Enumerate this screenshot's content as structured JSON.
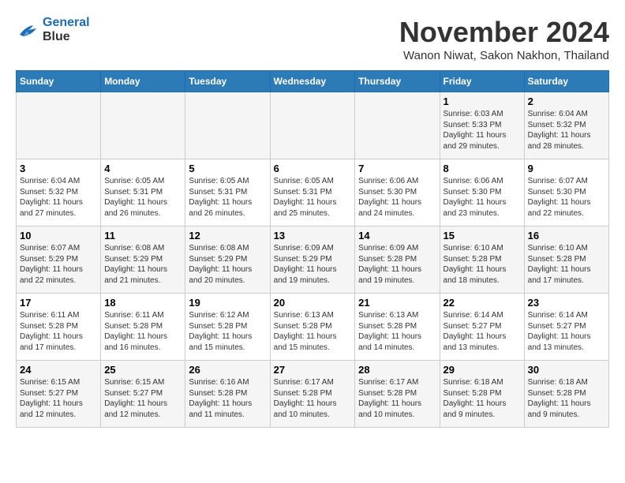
{
  "logo": {
    "line1": "General",
    "line2": "Blue"
  },
  "title": "November 2024",
  "location": "Wanon Niwat, Sakon Nakhon, Thailand",
  "days_of_week": [
    "Sunday",
    "Monday",
    "Tuesday",
    "Wednesday",
    "Thursday",
    "Friday",
    "Saturday"
  ],
  "weeks": [
    [
      {
        "day": "",
        "sunrise": "",
        "sunset": "",
        "daylight": ""
      },
      {
        "day": "",
        "sunrise": "",
        "sunset": "",
        "daylight": ""
      },
      {
        "day": "",
        "sunrise": "",
        "sunset": "",
        "daylight": ""
      },
      {
        "day": "",
        "sunrise": "",
        "sunset": "",
        "daylight": ""
      },
      {
        "day": "",
        "sunrise": "",
        "sunset": "",
        "daylight": ""
      },
      {
        "day": "1",
        "sunrise": "Sunrise: 6:03 AM",
        "sunset": "Sunset: 5:33 PM",
        "daylight": "Daylight: 11 hours and 29 minutes."
      },
      {
        "day": "2",
        "sunrise": "Sunrise: 6:04 AM",
        "sunset": "Sunset: 5:32 PM",
        "daylight": "Daylight: 11 hours and 28 minutes."
      }
    ],
    [
      {
        "day": "3",
        "sunrise": "Sunrise: 6:04 AM",
        "sunset": "Sunset: 5:32 PM",
        "daylight": "Daylight: 11 hours and 27 minutes."
      },
      {
        "day": "4",
        "sunrise": "Sunrise: 6:05 AM",
        "sunset": "Sunset: 5:31 PM",
        "daylight": "Daylight: 11 hours and 26 minutes."
      },
      {
        "day": "5",
        "sunrise": "Sunrise: 6:05 AM",
        "sunset": "Sunset: 5:31 PM",
        "daylight": "Daylight: 11 hours and 26 minutes."
      },
      {
        "day": "6",
        "sunrise": "Sunrise: 6:05 AM",
        "sunset": "Sunset: 5:31 PM",
        "daylight": "Daylight: 11 hours and 25 minutes."
      },
      {
        "day": "7",
        "sunrise": "Sunrise: 6:06 AM",
        "sunset": "Sunset: 5:30 PM",
        "daylight": "Daylight: 11 hours and 24 minutes."
      },
      {
        "day": "8",
        "sunrise": "Sunrise: 6:06 AM",
        "sunset": "Sunset: 5:30 PM",
        "daylight": "Daylight: 11 hours and 23 minutes."
      },
      {
        "day": "9",
        "sunrise": "Sunrise: 6:07 AM",
        "sunset": "Sunset: 5:30 PM",
        "daylight": "Daylight: 11 hours and 22 minutes."
      }
    ],
    [
      {
        "day": "10",
        "sunrise": "Sunrise: 6:07 AM",
        "sunset": "Sunset: 5:29 PM",
        "daylight": "Daylight: 11 hours and 22 minutes."
      },
      {
        "day": "11",
        "sunrise": "Sunrise: 6:08 AM",
        "sunset": "Sunset: 5:29 PM",
        "daylight": "Daylight: 11 hours and 21 minutes."
      },
      {
        "day": "12",
        "sunrise": "Sunrise: 6:08 AM",
        "sunset": "Sunset: 5:29 PM",
        "daylight": "Daylight: 11 hours and 20 minutes."
      },
      {
        "day": "13",
        "sunrise": "Sunrise: 6:09 AM",
        "sunset": "Sunset: 5:29 PM",
        "daylight": "Daylight: 11 hours and 19 minutes."
      },
      {
        "day": "14",
        "sunrise": "Sunrise: 6:09 AM",
        "sunset": "Sunset: 5:28 PM",
        "daylight": "Daylight: 11 hours and 19 minutes."
      },
      {
        "day": "15",
        "sunrise": "Sunrise: 6:10 AM",
        "sunset": "Sunset: 5:28 PM",
        "daylight": "Daylight: 11 hours and 18 minutes."
      },
      {
        "day": "16",
        "sunrise": "Sunrise: 6:10 AM",
        "sunset": "Sunset: 5:28 PM",
        "daylight": "Daylight: 11 hours and 17 minutes."
      }
    ],
    [
      {
        "day": "17",
        "sunrise": "Sunrise: 6:11 AM",
        "sunset": "Sunset: 5:28 PM",
        "daylight": "Daylight: 11 hours and 17 minutes."
      },
      {
        "day": "18",
        "sunrise": "Sunrise: 6:11 AM",
        "sunset": "Sunset: 5:28 PM",
        "daylight": "Daylight: 11 hours and 16 minutes."
      },
      {
        "day": "19",
        "sunrise": "Sunrise: 6:12 AM",
        "sunset": "Sunset: 5:28 PM",
        "daylight": "Daylight: 11 hours and 15 minutes."
      },
      {
        "day": "20",
        "sunrise": "Sunrise: 6:13 AM",
        "sunset": "Sunset: 5:28 PM",
        "daylight": "Daylight: 11 hours and 15 minutes."
      },
      {
        "day": "21",
        "sunrise": "Sunrise: 6:13 AM",
        "sunset": "Sunset: 5:28 PM",
        "daylight": "Daylight: 11 hours and 14 minutes."
      },
      {
        "day": "22",
        "sunrise": "Sunrise: 6:14 AM",
        "sunset": "Sunset: 5:27 PM",
        "daylight": "Daylight: 11 hours and 13 minutes."
      },
      {
        "day": "23",
        "sunrise": "Sunrise: 6:14 AM",
        "sunset": "Sunset: 5:27 PM",
        "daylight": "Daylight: 11 hours and 13 minutes."
      }
    ],
    [
      {
        "day": "24",
        "sunrise": "Sunrise: 6:15 AM",
        "sunset": "Sunset: 5:27 PM",
        "daylight": "Daylight: 11 hours and 12 minutes."
      },
      {
        "day": "25",
        "sunrise": "Sunrise: 6:15 AM",
        "sunset": "Sunset: 5:27 PM",
        "daylight": "Daylight: 11 hours and 12 minutes."
      },
      {
        "day": "26",
        "sunrise": "Sunrise: 6:16 AM",
        "sunset": "Sunset: 5:28 PM",
        "daylight": "Daylight: 11 hours and 11 minutes."
      },
      {
        "day": "27",
        "sunrise": "Sunrise: 6:17 AM",
        "sunset": "Sunset: 5:28 PM",
        "daylight": "Daylight: 11 hours and 10 minutes."
      },
      {
        "day": "28",
        "sunrise": "Sunrise: 6:17 AM",
        "sunset": "Sunset: 5:28 PM",
        "daylight": "Daylight: 11 hours and 10 minutes."
      },
      {
        "day": "29",
        "sunrise": "Sunrise: 6:18 AM",
        "sunset": "Sunset: 5:28 PM",
        "daylight": "Daylight: 11 hours and 9 minutes."
      },
      {
        "day": "30",
        "sunrise": "Sunrise: 6:18 AM",
        "sunset": "Sunset: 5:28 PM",
        "daylight": "Daylight: 11 hours and 9 minutes."
      }
    ]
  ]
}
